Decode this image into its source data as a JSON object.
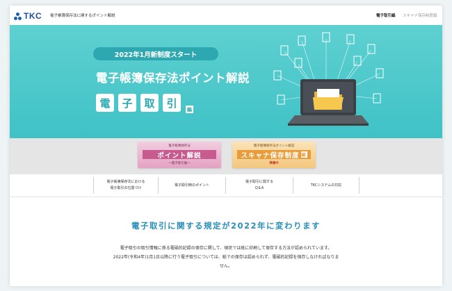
{
  "header": {
    "logo_text": "TKC",
    "site_title": "電子帳簿保存法に関するポイント解説",
    "nav": [
      {
        "label": "電子取引編",
        "active": true
      },
      {
        "label": "スキャナ保存制度編",
        "active": false
      }
    ]
  },
  "hero": {
    "badge": "2022年1月新制度スタート",
    "title": "電子帳簿保存法ポイント解説",
    "chars": [
      "電",
      "子",
      "取",
      "引"
    ],
    "suffix": "編"
  },
  "banners": [
    {
      "top": "電子帳簿保存法",
      "main": "ポイント解説",
      "sub": "〜電子取引編〜"
    },
    {
      "top": "電子帳簿保存法ポイント解説",
      "main": "スキャナ保存制度",
      "suffix": "編",
      "sub": "準備中"
    }
  ],
  "tabs": [
    {
      "line1": "電子帳簿保存法における",
      "line2": "電子取引の位置づけ"
    },
    {
      "line1": "電子取引時のポイント",
      "line2": ""
    },
    {
      "line1": "電子取引に関する",
      "line2": "Q＆A"
    },
    {
      "line1": "TKCシステムの対応",
      "line2": ""
    }
  ],
  "content": {
    "heading": "電子取引に関する規定が2022年に変わります",
    "lines": [
      "電子取引の取引情報に係る電磁的記録の保存に関して、現状では紙に印刷して保存する方法が認められています。",
      "2022年(令和4年)1月1日以降に行う電子取引については、紙での保存は認められず、電磁的記録を保存しなければなりま",
      "せん。"
    ]
  },
  "colors": {
    "hero_bg": "#45c5c8",
    "heading_blue": "#2a8fb8",
    "brand_blue": "#1d4f9c",
    "pink_banner": "#e4a2c2",
    "orange_banner": "#f3c77e"
  }
}
